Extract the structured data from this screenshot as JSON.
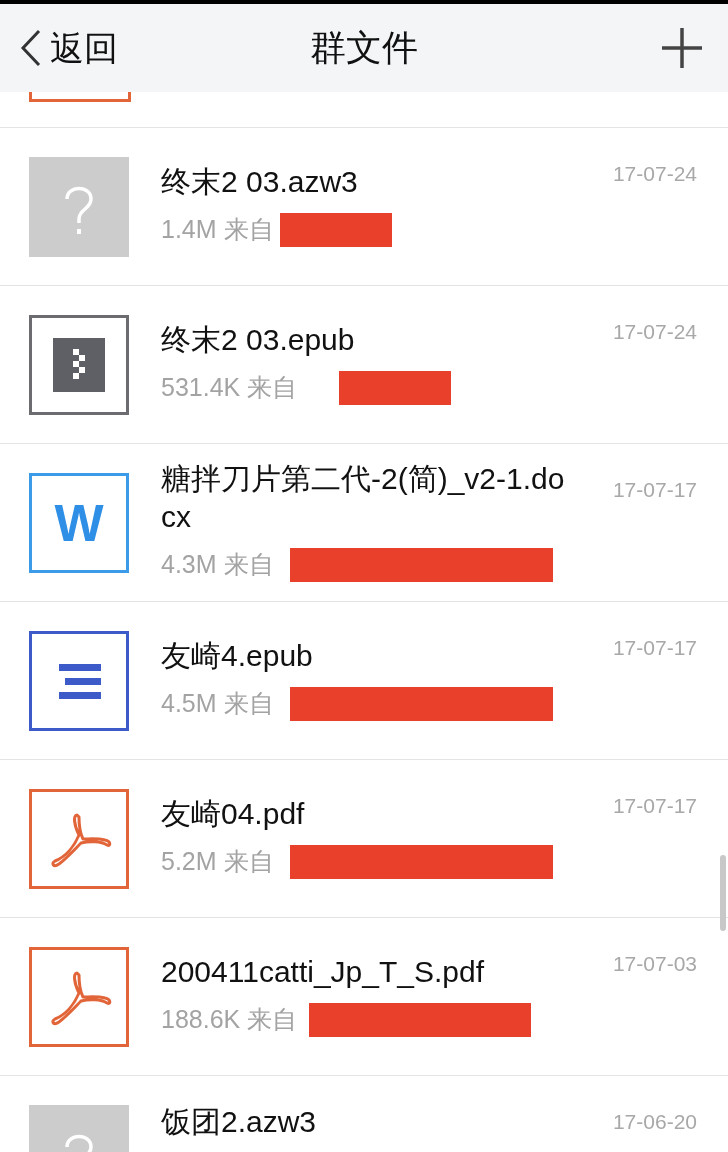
{
  "header": {
    "back": "返回",
    "title": "群文件"
  },
  "files": [
    {
      "kind": "unknown",
      "name": "终末2  03.azw3",
      "size": "1.4M 来自",
      "date": "17-07-24"
    },
    {
      "kind": "archive",
      "name": "终末2  03.epub",
      "size": "531.4K 来自",
      "date": "17-07-24"
    },
    {
      "kind": "word",
      "icon_text": "W",
      "name": "糖拌刀片第二代-2(简)_v2-1.docx",
      "size": "4.3M 来自",
      "date": "17-07-17"
    },
    {
      "kind": "epub",
      "name": "友崎4.epub",
      "size": "4.5M 来自",
      "date": "17-07-17"
    },
    {
      "kind": "pdf",
      "name": "友崎04.pdf",
      "size": "5.2M 来自",
      "date": "17-07-17"
    },
    {
      "kind": "pdf",
      "name": "200411catti_Jp_T_S.pdf",
      "size": "188.6K 来自",
      "date": "17-07-03"
    },
    {
      "kind": "unknown",
      "name": "饭团2.azw3",
      "date": "17-06-20"
    }
  ]
}
